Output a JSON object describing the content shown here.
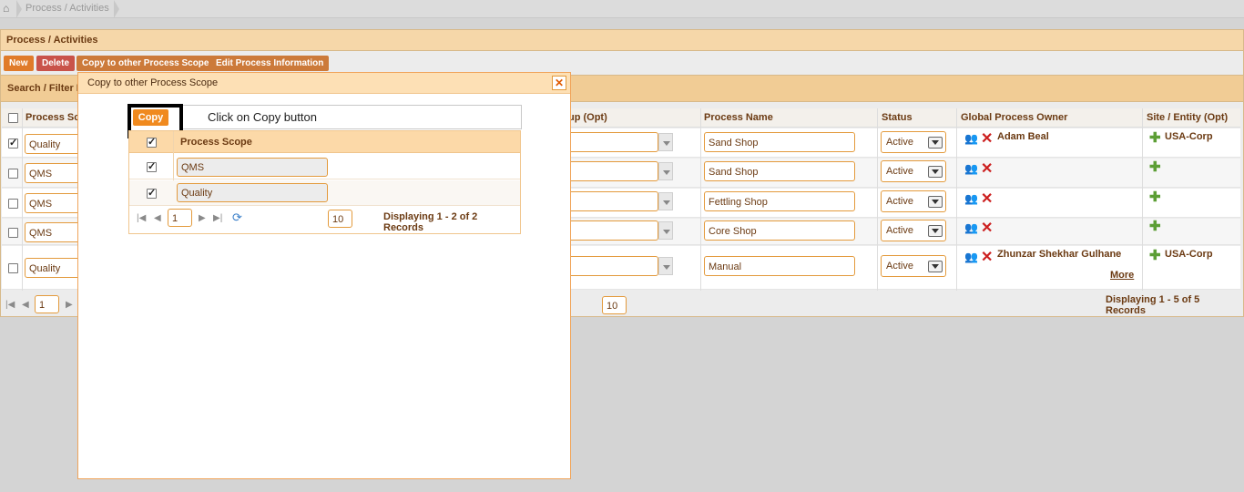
{
  "breadcrumb": {
    "path": "Process / Activities"
  },
  "panel": {
    "title": "Process / Activities"
  },
  "toolbar": {
    "new_label": "New",
    "delete_label": "Delete",
    "copy_label": "Copy to other Process Scope",
    "edit_label": "Edit Process Information"
  },
  "filter": {
    "title": "Search / Filter R"
  },
  "grid": {
    "headers": {
      "process_scope": "Process Sc",
      "group": "up (Opt)",
      "process_name": "Process Name",
      "status": "Status",
      "owner": "Global Process Owner",
      "site": "Site / Entity (Opt)"
    },
    "rows": [
      {
        "checked": true,
        "scope": "Quality",
        "name": "Sand Shop",
        "status": "Active",
        "owner": "Adam Beal",
        "site": "USA-Corp",
        "more": ""
      },
      {
        "checked": false,
        "scope": "QMS",
        "name": "Sand Shop",
        "status": "Active",
        "owner": "",
        "site": "",
        "more": ""
      },
      {
        "checked": false,
        "scope": "QMS",
        "name": "Fettling Shop",
        "status": "Active",
        "owner": "",
        "site": "",
        "more": ""
      },
      {
        "checked": false,
        "scope": "QMS",
        "name": "Core Shop",
        "status": "Active",
        "owner": "",
        "site": "",
        "more": ""
      },
      {
        "checked": false,
        "scope": "Quality",
        "name": "Manual",
        "status": "Active",
        "owner": "Zhunzar Shekhar Gulhane",
        "site": "USA-Corp",
        "more": "More"
      }
    ],
    "pager": {
      "page": "1",
      "page_size": "10",
      "records": "Displaying 1 - 5 of 5 Records"
    }
  },
  "modal": {
    "title": "Copy to other Process Scope",
    "copy_label": "Copy",
    "instruction": "Click on Copy button",
    "inner_header": "Process Scope",
    "rows": [
      {
        "checked": true,
        "scope": "QMS"
      },
      {
        "checked": true,
        "scope": "Quality"
      }
    ],
    "pager": {
      "page": "1",
      "page_size": "10",
      "records": "Displaying 1 - 2 of 2 Records"
    }
  },
  "colors": {
    "accent": "#e07b2a",
    "header_bg": "#f6d7a9",
    "text": "#6b3a12",
    "danger": "#cc1f1f"
  }
}
